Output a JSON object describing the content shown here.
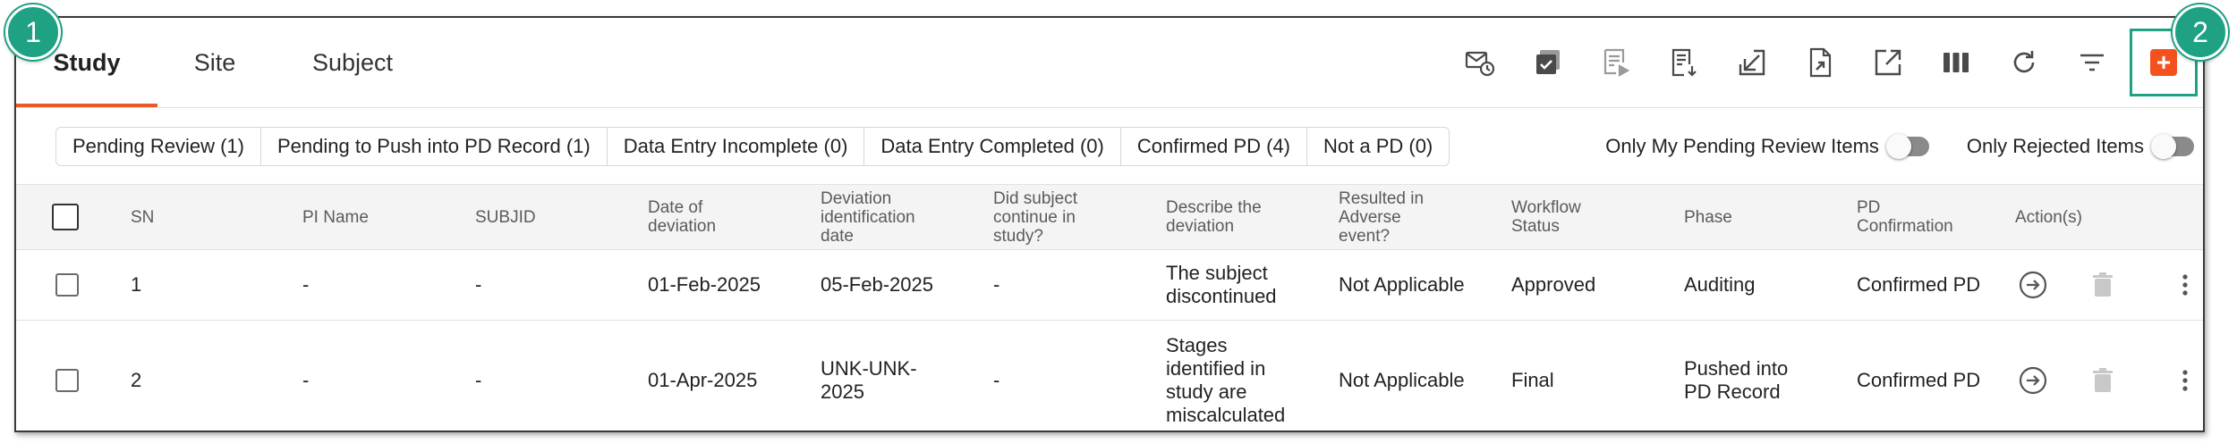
{
  "tabs": [
    {
      "label": "Study",
      "active": true
    },
    {
      "label": "Site",
      "active": false
    },
    {
      "label": "Subject",
      "active": false
    }
  ],
  "toolbar": {
    "icons": [
      "mail-clock-icon",
      "checklist-icon",
      "play-list-icon",
      "download-list-icon",
      "arrow-in-icon",
      "export-file-icon",
      "open-external-icon",
      "columns-icon",
      "refresh-icon",
      "filter-icon",
      "add-icon"
    ],
    "add_label": "+",
    "highlight_color": "#1fa184",
    "add_color": "#f4511e"
  },
  "filters": [
    "Pending Review (1)",
    "Pending to Push into PD Record (1)",
    "Data Entry Incomplete (0)",
    "Data Entry Completed (0)",
    "Confirmed PD (4)",
    "Not a PD (0)"
  ],
  "toggles": [
    {
      "label": "Only My Pending Review Items",
      "on": false
    },
    {
      "label": "Only Rejected Items",
      "on": false
    }
  ],
  "table": {
    "headers": {
      "sn": "SN",
      "pi_name": "PI Name",
      "subjid": "SUBJID",
      "date_of_deviation": "Date of deviation",
      "deviation_identification_date": "Deviation identification date",
      "continue_in_study": "Did subject continue in study?",
      "describe": "Describe the deviation",
      "adverse_event": "Resulted in Adverse event?",
      "workflow_status": "Workflow Status",
      "phase": "Phase",
      "pd_confirmation": "PD Confirmation",
      "actions": "Action(s)"
    },
    "rows": [
      {
        "sn": "1",
        "pi_name": "-",
        "subjid": "-",
        "date_of_deviation": "01-Feb-2025",
        "deviation_identification_date": "05-Feb-2025",
        "continue_in_study": "-",
        "describe": "The subject discontinued",
        "adverse_event": "Not Applicable",
        "workflow_status": "Approved",
        "phase": "Auditing",
        "pd_confirmation": "Confirmed PD"
      },
      {
        "sn": "2",
        "pi_name": "-",
        "subjid": "-",
        "date_of_deviation": "01-Apr-2025",
        "deviation_identification_date": "UNK-UNK-2025",
        "continue_in_study": "-",
        "describe": "Stages identified in study are miscalculated",
        "adverse_event": "Not Applicable",
        "workflow_status": "Final",
        "phase": "Pushed into PD Record",
        "pd_confirmation": "Confirmed PD"
      }
    ]
  },
  "badges": [
    "1",
    "2"
  ]
}
